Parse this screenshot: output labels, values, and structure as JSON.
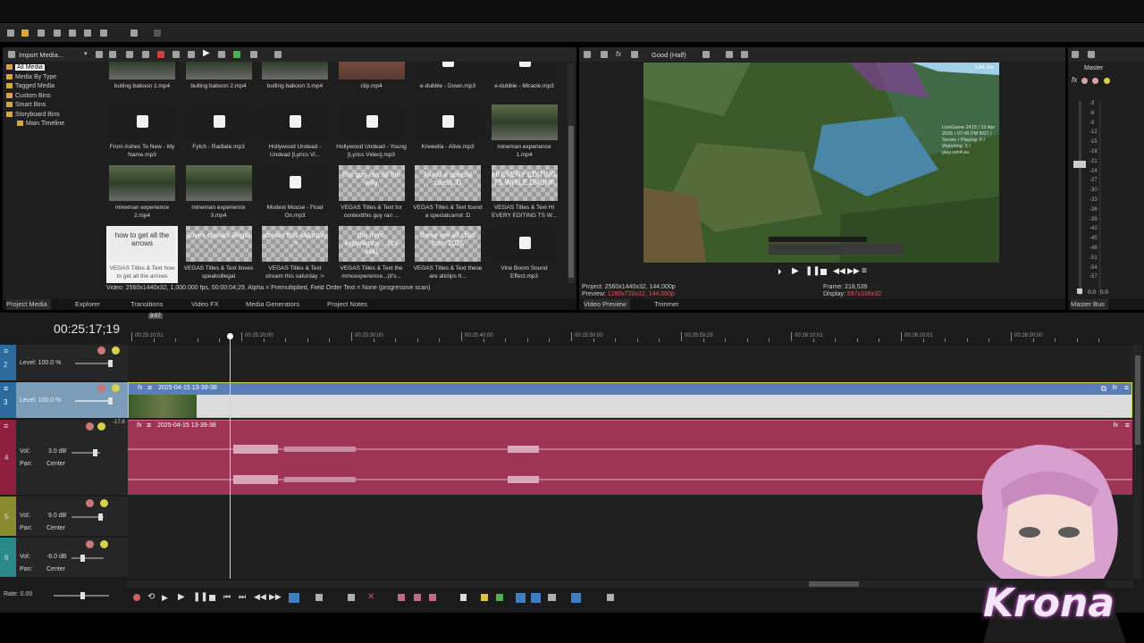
{
  "explorer": {
    "dropdown_label": "Import Media...",
    "tree": [
      "All Media",
      "Media By Type",
      "Tagged Media",
      "Custom Bins",
      "Smart Bins",
      "Storyboard Bins",
      "Main Timeline"
    ],
    "status": "Video: 2560x1440x32, 1,000.000 fps, 00:00:04;29, Alpha = Premultiplied, Field Order Text = None (progressive scan)",
    "tabs": [
      "Project Media",
      "Explorer",
      "Transitions",
      "Video FX",
      "Media Generators",
      "Project Notes"
    ]
  },
  "media": [
    {
      "cap": "bulling baboon 1.mp4",
      "kind": "mc"
    },
    {
      "cap": "bulling baboon 2.mp4",
      "kind": "mc"
    },
    {
      "cap": "bulling baboon 3.mp4",
      "kind": "mc"
    },
    {
      "cap": "clip.mp4",
      "kind": "clip"
    },
    {
      "cap": "e-dubble - Down.mp3",
      "kind": "snd"
    },
    {
      "cap": "e-dubble - Miracle.mp3",
      "kind": "snd"
    },
    {
      "cap": "From Ashes To New - My Name.mp3",
      "kind": "snd"
    },
    {
      "cap": "Fytch - Radiate.mp3",
      "kind": "snd"
    },
    {
      "cap": "Hollywood Undead - Undead [Lyrics Vi...",
      "kind": "snd"
    },
    {
      "cap": "Hollywood Undead - Young [Lyrics Video].mp3",
      "kind": "snd"
    },
    {
      "cap": "Krewella - Alive.mp3",
      "kind": "snd"
    },
    {
      "cap": "mineman experience 1.mp4",
      "kind": "mc"
    },
    {
      "cap": "mineman experience 2.mp4",
      "kind": "mc"
    },
    {
      "cap": "mineman experience 3.mp4",
      "kind": "mc"
    },
    {
      "cap": "Modest Mouse - Float On.mp3",
      "kind": "snd"
    },
    {
      "cap": "VEGAS Titles & Text for contextthis guy ran ...",
      "kind": "txt",
      "txt": "this guy ran all the way"
    },
    {
      "cap": "VEGAS Titles & Text found a specialcarrot :D",
      "kind": "txt",
      "txt": "found a special carrot :D"
    },
    {
      "cap": "VEGAS Titles & Text HI EVERY EDITING TS W...",
      "kind": "txt",
      "txt": "HI EVERY EDITING TS WHILE DRUNK"
    },
    {
      "cap": "VEGAS Titles & Text ilovex speaksillegal",
      "kind": "txt",
      "txt": "ilovex speaks illegal"
    },
    {
      "cap": "VEGAS Titles & Text stream this saturday :>",
      "kind": "txt",
      "txt": "stream this saturday :>"
    },
    {
      "cap": "VEGAS Titles & Text the mmcexperience...(it's...",
      "kind": "txt",
      "txt": "the mmc experience... (it's ass)"
    },
    {
      "cap": "VEGAS Titles & Text these are allclips fr...",
      "kind": "txt",
      "txt": "these are all clips from 2025"
    },
    {
      "cap": "Vine Boom Sound Effect.mp3",
      "kind": "snd"
    }
  ],
  "selected_media": {
    "txt": "how to get all the arrows",
    "cap": "VEGAS Titles & Text how to get all the arrows"
  },
  "preview": {
    "quality": "Good (Half)",
    "project": "Project: 2560x1440x32, 144.000p",
    "preview_label": "Preview:",
    "preview_val": "1280x720x32, 144.000p",
    "frame": "Frame:   218,539",
    "display_label": "Display:",
    "display_val": "597x336x32",
    "hud_top": "134 ms",
    "hud_right": "LiveGame 2415 / 15 Apr 2025 / 07:45 PM BST / Server / Playing: 6 / Watching: 5 / play.ssh4.eu",
    "tabs": [
      "Video Preview",
      "Trimmer"
    ]
  },
  "master": {
    "title": "Master",
    "scale": [
      "3",
      "6",
      "9",
      "12",
      "15",
      "18",
      "21",
      "24",
      "27",
      "30",
      "33",
      "36",
      "39",
      "42",
      "45",
      "48",
      "51",
      "54",
      "57"
    ],
    "values": [
      "0.0",
      "0.0"
    ],
    "tab": "Master Bus"
  },
  "timeline": {
    "timecode": "00:25:17;19",
    "ruler": [
      "00:25:10;01",
      "00:25:20;00",
      "00:25:30;00",
      "00:25:40;00",
      "00:25:50;00",
      "00:25:59;29",
      "00:26:10;01",
      "00:26:20;01",
      "00:26:30;00"
    ],
    "marker": "3:07",
    "tracks": [
      {
        "num": "2",
        "level": "Level: 100.0 %",
        "color": "#2d6a9e"
      },
      {
        "num": "3",
        "level": "Level: 100.0 %",
        "color": "#2d6a9e"
      },
      {
        "num": "4",
        "vol": "Vol:",
        "vol_val": "3.0 dB",
        "pan": "Pan:",
        "pan_val": "Center",
        "color": "#8e1f3d"
      },
      {
        "num": "5",
        "vol": "Vol:",
        "vol_val": "9.0 dB",
        "pan": "Pan:",
        "pan_val": "Center",
        "color": "#8a8a2e"
      },
      {
        "num": "6",
        "vol": "Vol:",
        "vol_val": "-6.0 dB",
        "pan": "Pan:",
        "pan_val": "Center",
        "color": "#2a8a8a"
      }
    ],
    "video_clip": "2025-04-15 13-39-38",
    "audio_clip": "2025-04-15 13-39-38",
    "audio_peak": "-17.6",
    "rate": "Rate: 0.00"
  },
  "overlay": {
    "text": "Krona"
  }
}
